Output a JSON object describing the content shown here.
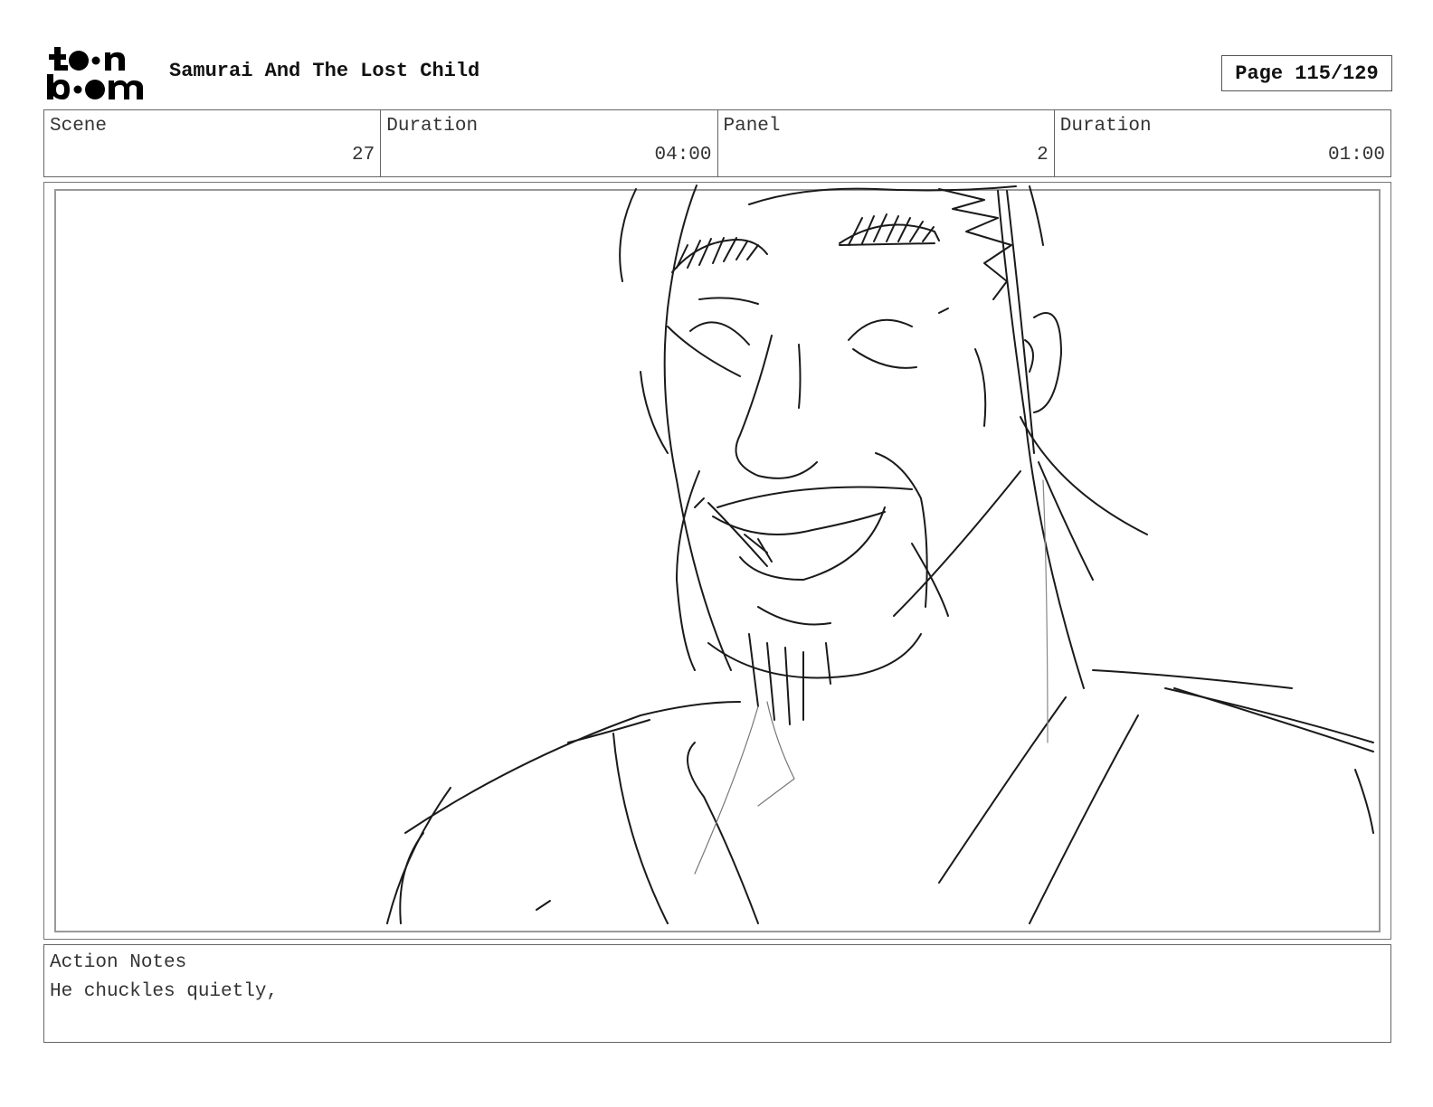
{
  "header": {
    "logo_text": "toon boom",
    "title": "Samurai And The Lost Child",
    "page": "Page 115/129"
  },
  "info": {
    "scene_label": "Scene",
    "scene_value": "27",
    "scene_duration_label": "Duration",
    "scene_duration_value": "04:00",
    "panel_label": "Panel",
    "panel_value": "2",
    "panel_duration_label": "Duration",
    "panel_duration_value": "01:00"
  },
  "notes": {
    "label": "Action Notes",
    "text": "He chuckles quietly,"
  }
}
